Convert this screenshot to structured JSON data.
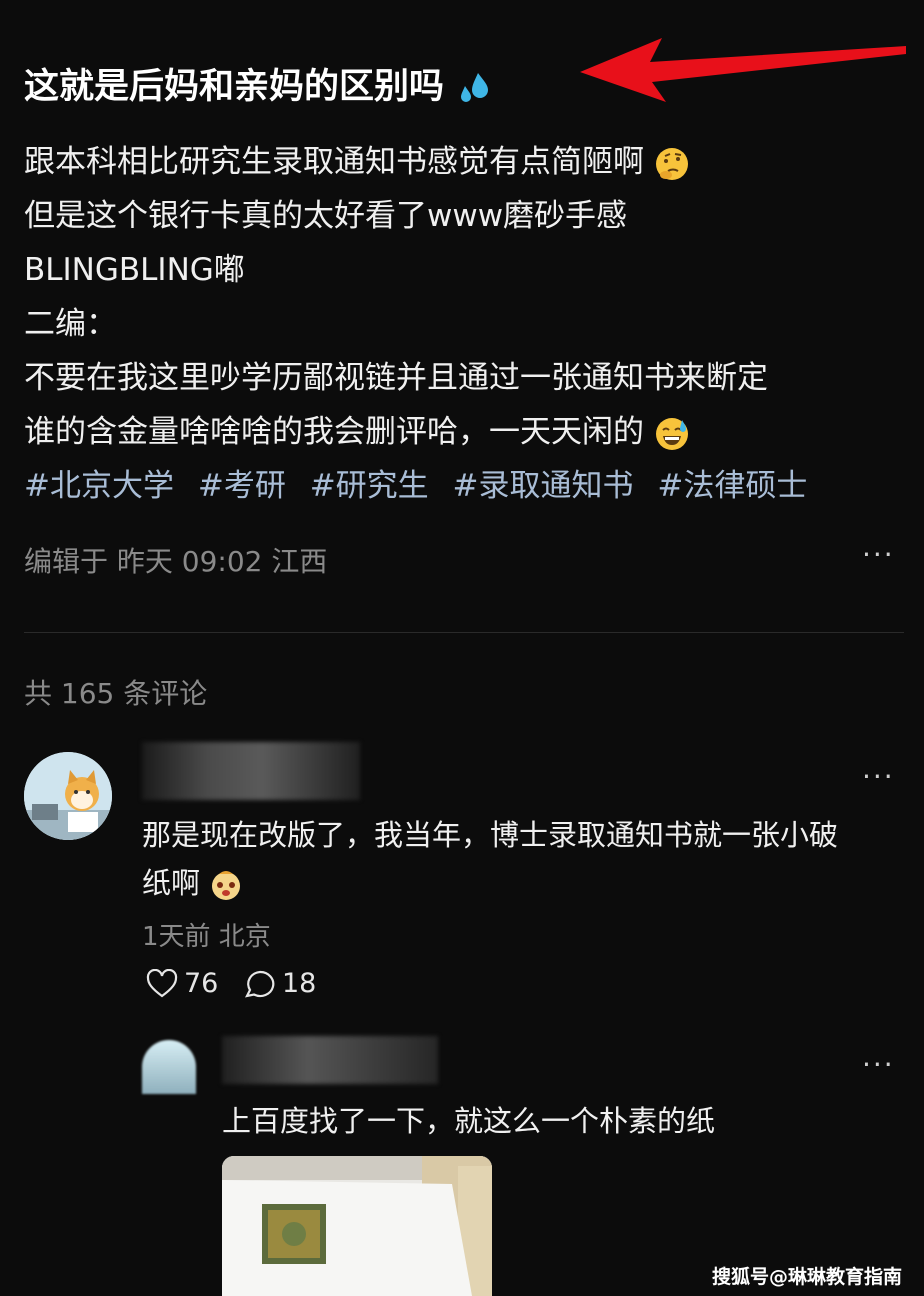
{
  "post": {
    "title": "这就是后妈和亲妈的区别吗",
    "lines": [
      "跟本科相比研究生录取通知书感觉有点简陋啊",
      "但是这个银行卡真的太好看了www磨砂手感",
      "BLINGBLING嘟",
      "二编：",
      "不要在我这里吵学历鄙视链并且通过一张通知书来断定",
      "谁的含金量啥啥啥的我会删评哈，一天天闲的"
    ],
    "tags": [
      "#北京大学",
      "#考研",
      "#研究生",
      "#录取通知书",
      "#法律硕士"
    ],
    "meta": "编辑于 昨天 09:02 江西",
    "more": "···"
  },
  "comments_header": {
    "count_text": "共 165 条评论"
  },
  "comment": {
    "text_line1": "那是现在改版了，我当年，博士录取通知书就一张小破",
    "text_line2": "纸啊",
    "meta": "1天前 北京",
    "likes": "76",
    "replies": "18",
    "more": "···"
  },
  "reply": {
    "text": "上百度找了一下，就这么一个朴素的纸",
    "more": "···"
  },
  "watermark": "搜狐号@琳琳教育指南",
  "colors": {
    "background": "#0c0c0c",
    "tag": "#a9bdd6",
    "arrow": "#e8101a",
    "muted": "#8a8a8a"
  }
}
